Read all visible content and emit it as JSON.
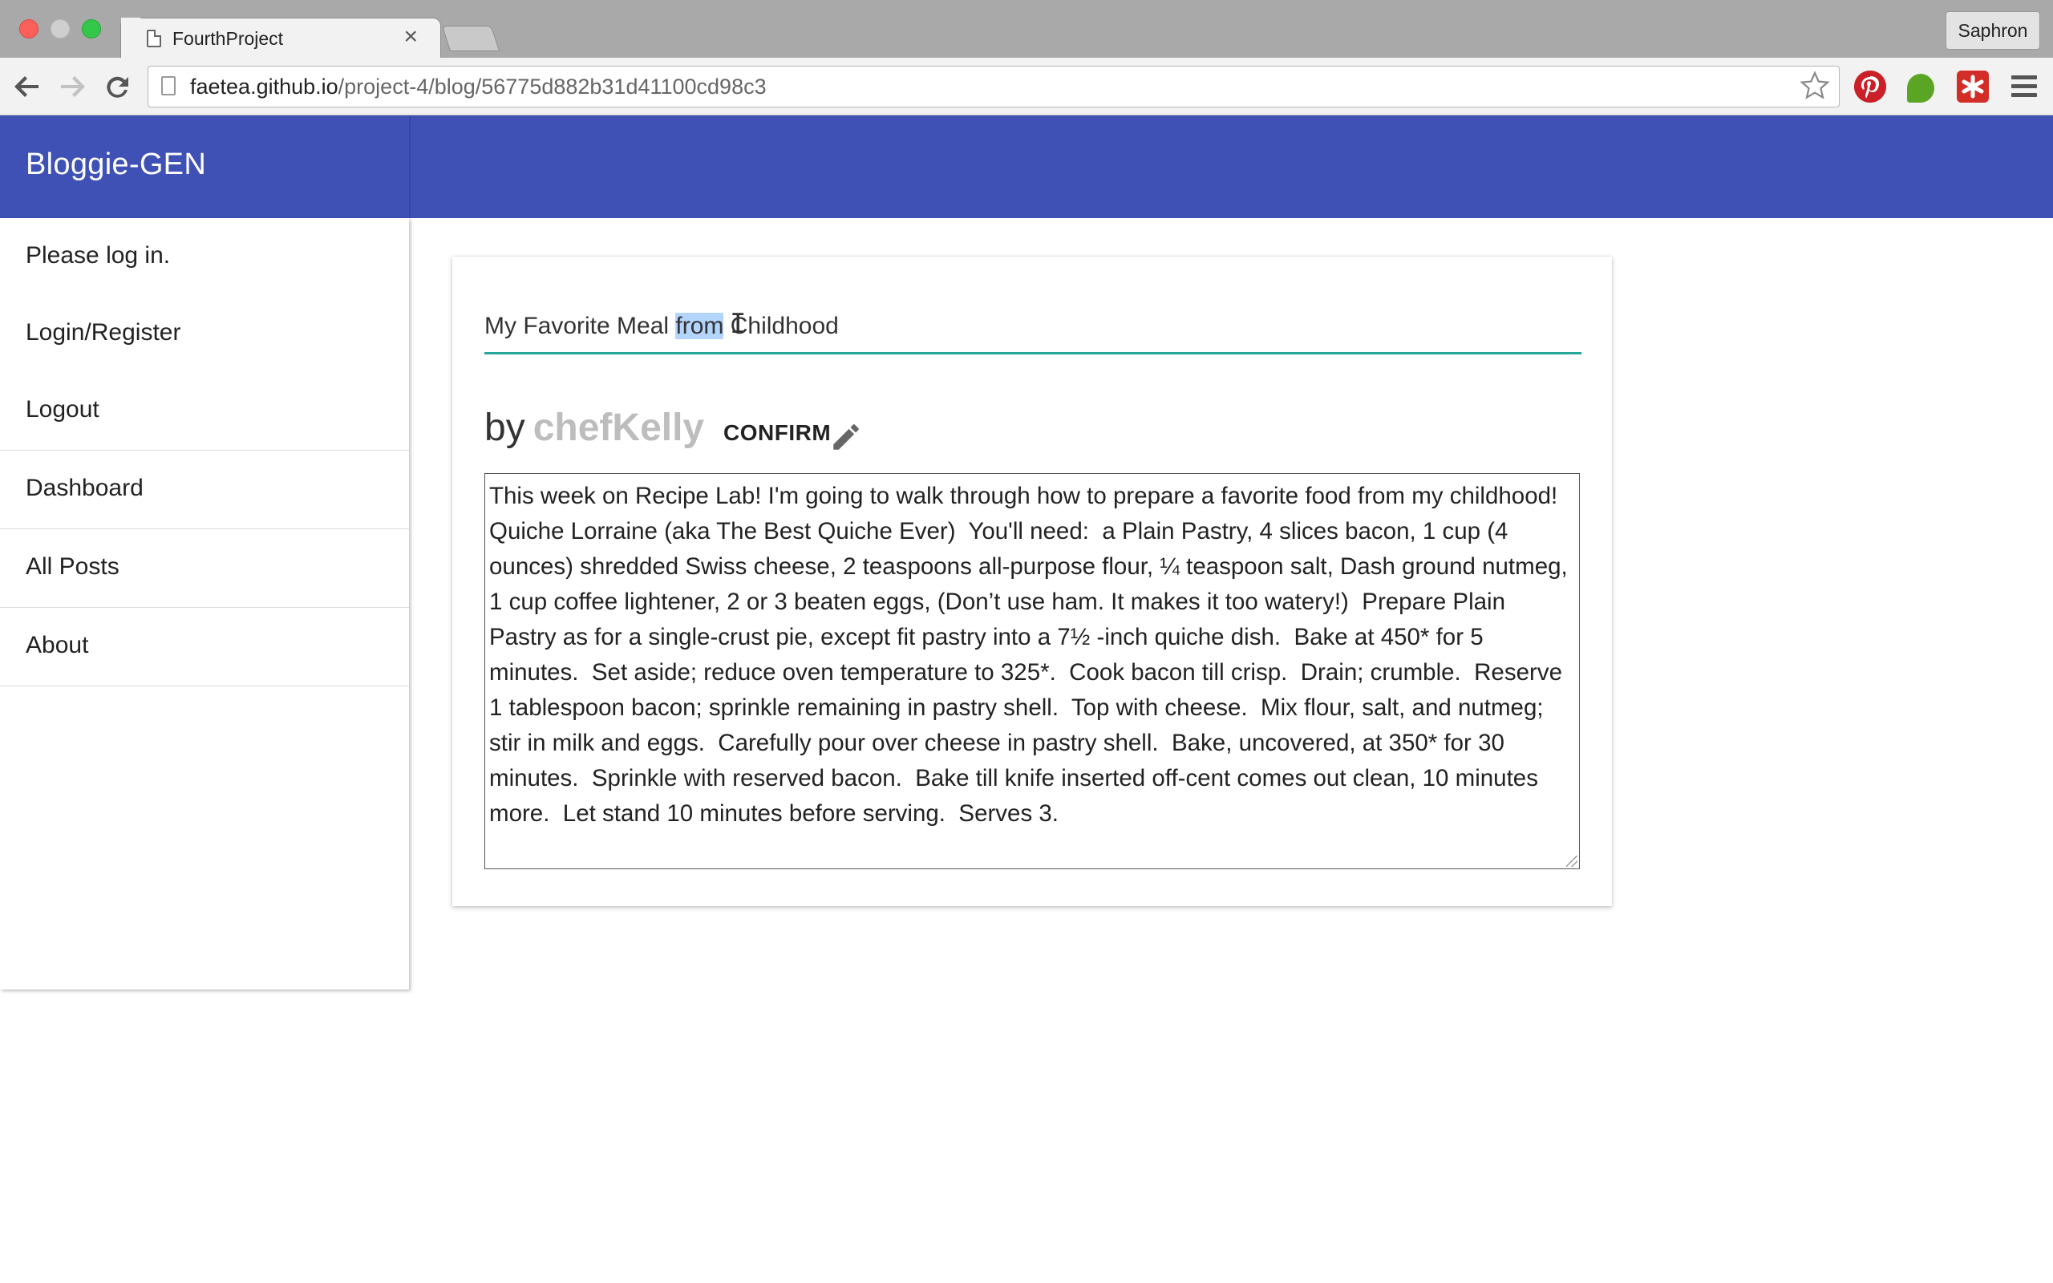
{
  "browser": {
    "tab_title": "FourthProject",
    "tab_close": "×",
    "profile_name": "Saphron",
    "url_domain": "faetea.github.io",
    "url_path": "/project-4/blog/56775d882b31d41100cd98c3",
    "icons": [
      "back-arrow-icon",
      "forward-arrow-icon",
      "reload-icon",
      "page-icon",
      "star-icon",
      "pinterest-icon",
      "evernote-icon",
      "lastpass-icon",
      "menu-icon"
    ]
  },
  "app": {
    "brand": "Bloggie-GEN",
    "accent_color": "#3f51b5",
    "underline_color": "#26a69a"
  },
  "sidebar": {
    "items": [
      {
        "label": "Please log in."
      },
      {
        "label": "Login/Register"
      },
      {
        "label": "Logout"
      },
      {
        "label": "Dashboard"
      },
      {
        "label": "All Posts"
      },
      {
        "label": "About"
      }
    ]
  },
  "post": {
    "title_before": "My Favorite Meal ",
    "title_selected": "from",
    "title_after": " Childhood",
    "by_prefix": "by",
    "author": "chefKelly",
    "confirm_label": "CONFIRM",
    "body": "This week on Recipe Lab! I'm going to walk through how to prepare a favorite food from my childhood!  Quiche Lorraine (aka The Best Quiche Ever)  You'll need:  a Plain Pastry, 4 slices bacon, 1 cup (4 ounces) shredded Swiss cheese, 2 teaspoons all-purpose flour, ¼ teaspoon salt, Dash ground nutmeg, 1 cup coffee lightener, 2 or 3 beaten eggs, (Don’t use ham. It makes it too watery!)  Prepare Plain Pastry as for a single-crust pie, except fit pastry into a 7½ -inch quiche dish.  Bake at 450* for 5 minutes.  Set aside; reduce oven temperature to 325*.  Cook bacon till crisp.  Drain; crumble.  Reserve 1 tablespoon bacon; sprinkle remaining in pastry shell.  Top with cheese.  Mix flour, salt, and nutmeg; stir in milk and eggs.  Carefully pour over cheese in pastry shell.  Bake, uncovered, at 350* for 30 minutes.  Sprinkle with reserved bacon.  Bake till knife inserted off-cent comes out clean, 10 minutes more.  Let stand 10 minutes before serving.  Serves 3."
  }
}
